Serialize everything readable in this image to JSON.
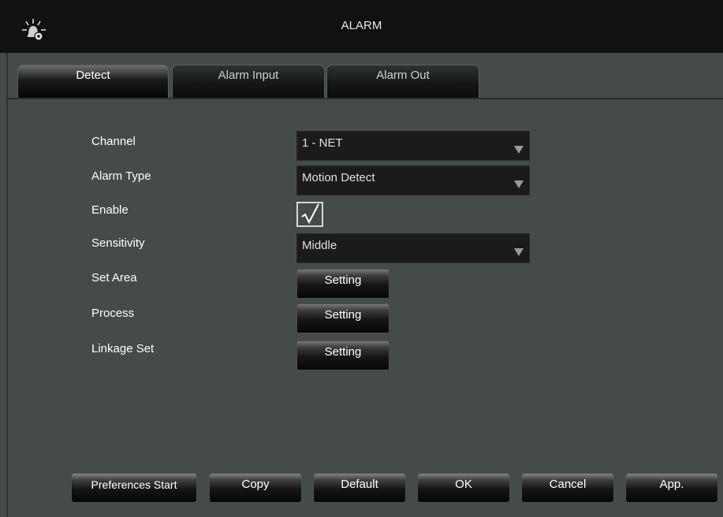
{
  "window": {
    "title": "ALARM",
    "icon": "alarm-settings-icon"
  },
  "tabs": [
    {
      "label": "Detect",
      "active": true
    },
    {
      "label": "Alarm Input",
      "active": false
    },
    {
      "label": "Alarm Out",
      "active": false
    }
  ],
  "form": {
    "channel": {
      "label": "Channel",
      "value": "1 - NET"
    },
    "alarm_type": {
      "label": "Alarm Type",
      "value": "Motion Detect"
    },
    "enable": {
      "label": "Enable",
      "checked": true,
      "mark": "√"
    },
    "sensitivity": {
      "label": "Sensitivity",
      "value": "Middle"
    },
    "set_area": {
      "label": "Set Area",
      "button": "Setting"
    },
    "process": {
      "label": "Process",
      "button": "Setting"
    },
    "linkage_set": {
      "label": "Linkage Set",
      "button": "Setting"
    }
  },
  "buttons": {
    "preferences_start": "Preferences Start",
    "copy": "Copy",
    "default": "Default",
    "ok": "OK",
    "cancel": "Cancel",
    "apply": "App."
  },
  "colors": {
    "panel": "#454b48",
    "titlebar": "#111111",
    "field": "#1b1b1b"
  }
}
